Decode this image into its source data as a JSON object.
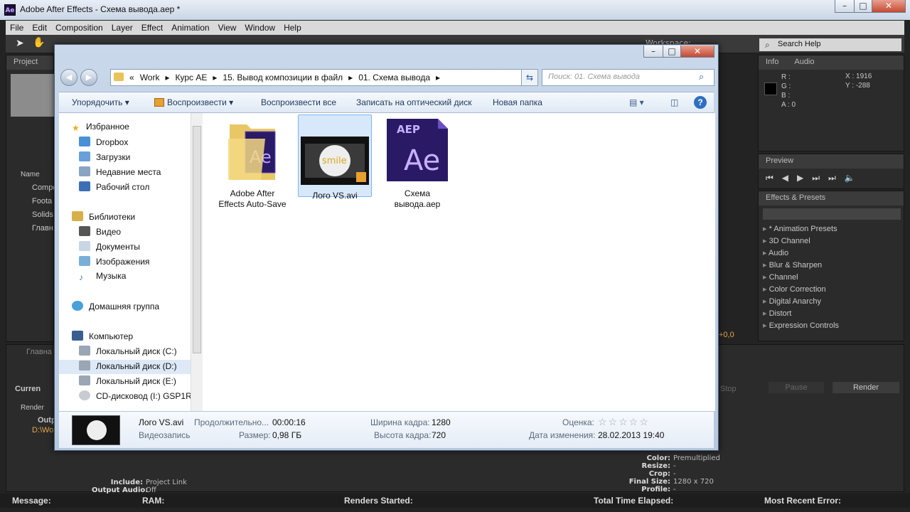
{
  "ae": {
    "app_icon": "Ae",
    "window_title": "Adobe After Effects - Схема вывода.aep *",
    "menu": [
      "File",
      "Edit",
      "Composition",
      "Layer",
      "Effect",
      "Animation",
      "View",
      "Window",
      "Help"
    ],
    "search_help": "Search Help",
    "workspace_label": "Workspace:",
    "project_panel": {
      "tab": "Project",
      "column_name": "Name",
      "items": [
        "Composi",
        "Foota",
        "Solids",
        "Главн"
      ]
    },
    "info_panel": {
      "tabs": [
        "Info",
        "Audio"
      ],
      "rgb_labels": [
        "R :",
        "G :",
        "B :",
        "A : 0"
      ],
      "x_readout": "X : 1916",
      "y_readout": "Y : -288"
    },
    "preview_panel": {
      "tab": "Preview"
    },
    "effects_panel": {
      "tab": "Effects & Presets",
      "items": [
        "* Animation Presets",
        "3D Channel",
        "Audio",
        "Blur & Sharpen",
        "Channel",
        "Color Correction",
        "Digital Anarchy",
        "Distort",
        "Expression Controls"
      ]
    },
    "render_queue": {
      "current_label": "Curren",
      "stop_button": "Stop",
      "pause_button": "Pause",
      "render_button": "Render",
      "render_col": "Render",
      "output_label": "Outpu",
      "output_path": "D:\\Wo",
      "comp_tab": "Главна",
      "offset_value": "+0,0",
      "output_module_info": [
        {
          "k": "Include:",
          "v": "Project Link"
        },
        {
          "k": "Output Audio:",
          "v": "Off"
        }
      ],
      "settings_info": [
        {
          "k": "Color:",
          "v": "Premultiplied"
        },
        {
          "k": "Resize:",
          "v": "-"
        },
        {
          "k": "Crop:",
          "v": "-"
        },
        {
          "k": "Final Size:",
          "v": "1280 x 720"
        },
        {
          "k": "Profile:",
          "v": "-"
        }
      ]
    },
    "status_bar": {
      "message": "Message:",
      "ram": "RAM:",
      "renders_started": "Renders Started:",
      "total_time": "Total Time Elapsed:",
      "recent_error": "Most Recent Error:"
    }
  },
  "explorer": {
    "breadcrumb": [
      "«",
      "Work",
      "Курс AE",
      "15. Вывод композиции в файл",
      "01. Схема вывода"
    ],
    "search_placeholder": "Поиск: 01. Схема вывода",
    "commands": {
      "organize": "Упорядочить",
      "play": "Воспроизвести",
      "play_all": "Воспроизвести все",
      "burn": "Записать на оптический диск",
      "new_folder": "Новая папка"
    },
    "nav": {
      "favorites": "Избранное",
      "favorites_items": [
        "Dropbox",
        "Загрузки",
        "Недавние места",
        "Рабочий стол"
      ],
      "libraries": "Библиотеки",
      "libraries_items": [
        "Видео",
        "Документы",
        "Изображения",
        "Музыка"
      ],
      "homegroup": "Домашняя группа",
      "computer": "Компьютер",
      "computer_items": [
        "Локальный диск (C:)",
        "Локальный диск (D:)",
        "Локальный диск (E:)",
        "CD-дисковод (I:) GSP1RM"
      ]
    },
    "files": [
      {
        "name_line1": "Adobe After",
        "name_line2": "Effects Auto-Save"
      },
      {
        "name_line1": "Лого VS.avi",
        "name_line2": ""
      },
      {
        "name_line1": "Схема",
        "name_line2": "вывода.aep"
      }
    ],
    "aep_badge": "AEP",
    "aep_letters": "Ae",
    "video_thumb_text": "smile",
    "details": {
      "filename": "Лого VS.avi",
      "filetype": "Видеозапись",
      "duration_label": "Продолжительно...",
      "duration": "00:00:16",
      "size_label": "Размер:",
      "size": "0,98 ГБ",
      "width_label": "Ширина кадра:",
      "width": "1280",
      "height_label": "Высота кадра:",
      "height": "720",
      "rating_label": "Оценка:",
      "rating_stars": "☆☆☆☆☆",
      "modified_label": "Дата изменения:",
      "modified": "28.02.2013 19:40"
    }
  },
  "colors": {
    "ae_bg": "#232323",
    "explorer_chrome": "#b4c8e0",
    "selection": "#d7e8fb",
    "ae_purple": "#2a1a66"
  }
}
